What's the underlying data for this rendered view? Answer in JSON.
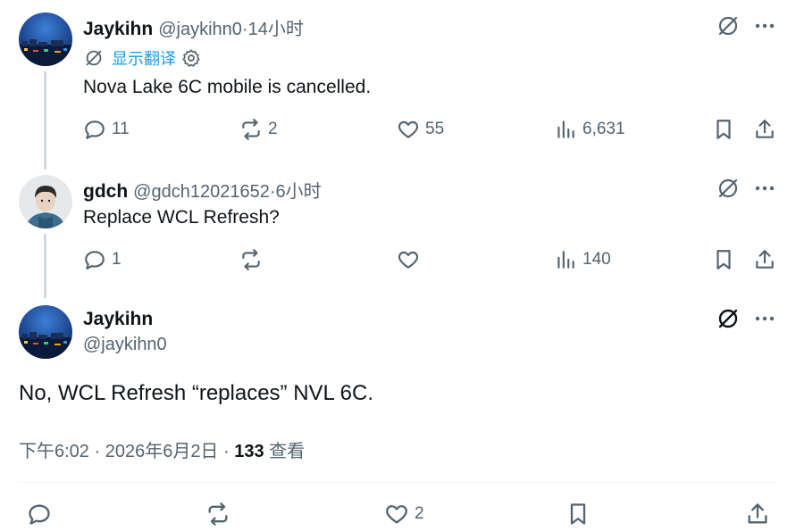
{
  "tweets": [
    {
      "name": "Jaykihn",
      "handle": "@jaykihn0",
      "time": "14小时",
      "translate_label": "显示翻译",
      "text": "Nova Lake 6C mobile is cancelled.",
      "replies": "11",
      "reposts": "2",
      "likes": "55",
      "views": "6,631"
    },
    {
      "name": "gdch",
      "handle": "@gdch12021652",
      "time": "6小时",
      "text": "Replace WCL Refresh?",
      "replies": "1",
      "reposts": "",
      "likes": "",
      "views": "140"
    }
  ],
  "main": {
    "name": "Jaykihn",
    "handle": "@jaykihn0",
    "text": "No, WCL Refresh “replaces” NVL 6C.",
    "time_date": "下午6:02 · 2026年6月2日 · ",
    "views_count": "133",
    "views_label": " 查看",
    "likes": "2"
  },
  "separator": " · ",
  "icons": [
    "grok-icon",
    "more-icon",
    "reply-icon",
    "repost-icon",
    "like-icon",
    "views-icon",
    "bookmark-icon",
    "share-icon",
    "translate-icon",
    "settings-icon"
  ],
  "colors": {
    "text": "#0f1419",
    "muted": "#536471",
    "link": "#1d9bf0",
    "line": "#cfd9de"
  }
}
